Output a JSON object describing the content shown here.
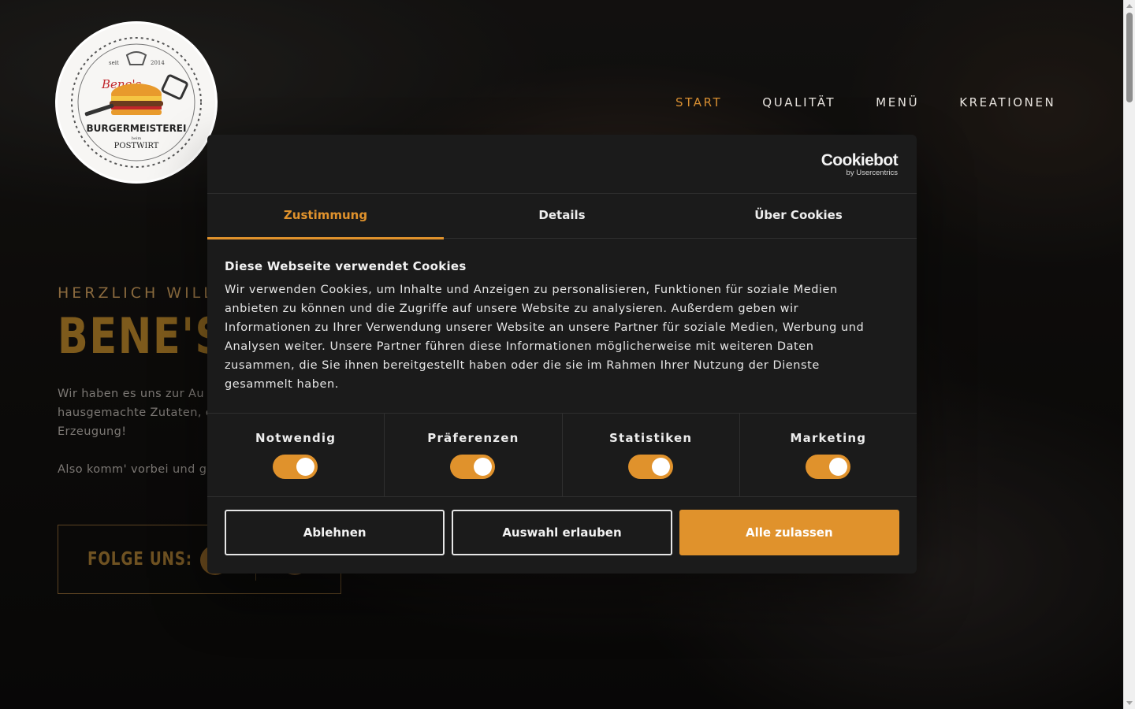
{
  "logo": {
    "alt_name": "Bene's Burgermeisterei beim Postwirt logo",
    "text_script": "Bene's",
    "text_main": "BURGERMEISTEREI",
    "text_small": "beim",
    "text_bottom": "POSTWIRT",
    "year_left": "seit",
    "year_right": "2014"
  },
  "nav": {
    "items": [
      {
        "label": "START",
        "active": true
      },
      {
        "label": "QUALITÄT",
        "active": false
      },
      {
        "label": "MENÜ",
        "active": false
      },
      {
        "label": "KREATIONEN",
        "active": false
      }
    ]
  },
  "hero": {
    "welcome": "HERZLICH WILL",
    "title": "BENE'S",
    "text_line1": "Wir haben es uns zur Au",
    "text_line2": "hausgemachte Zutaten, d",
    "text_line3": "Erzeugung!",
    "text_line4": "Also komm' vorbei und g",
    "follow_label": "FOLGE UNS:"
  },
  "cookie_dialog": {
    "brand_main": "Cookiebot",
    "brand_sub": "by Usercentrics",
    "tabs": [
      {
        "label": "Zustimmung",
        "active": true
      },
      {
        "label": "Details",
        "active": false
      },
      {
        "label": "Über Cookies",
        "active": false
      }
    ],
    "title": "Diese Webseite verwendet Cookies",
    "text_lines": [
      "Wir verwenden Cookies, um Inhalte und Anzeigen zu personalisieren, Funktionen für soziale Medien",
      "anbieten zu können und die Zugriffe auf unsere Website zu analysieren. Außerdem geben wir",
      "Informationen zu Ihrer Verwendung unserer Website an unsere Partner für soziale Medien, Werbung und",
      "Analysen weiter. Unsere Partner führen diese Informationen möglicherweise mit weiteren Daten",
      "zusammen, die Sie ihnen bereitgestellt haben oder die sie im Rahmen Ihrer Nutzung der Dienste",
      "gesammelt haben."
    ],
    "toggles": [
      {
        "label": "Notwendig",
        "on": true
      },
      {
        "label": "Präferenzen",
        "on": true
      },
      {
        "label": "Statistiken",
        "on": true
      },
      {
        "label": "Marketing",
        "on": true
      }
    ],
    "buttons": {
      "decline": "Ablehnen",
      "allow_selection": "Auswahl erlauben",
      "allow_all": "Alle zulassen"
    },
    "accent_color": "#e0922c"
  }
}
